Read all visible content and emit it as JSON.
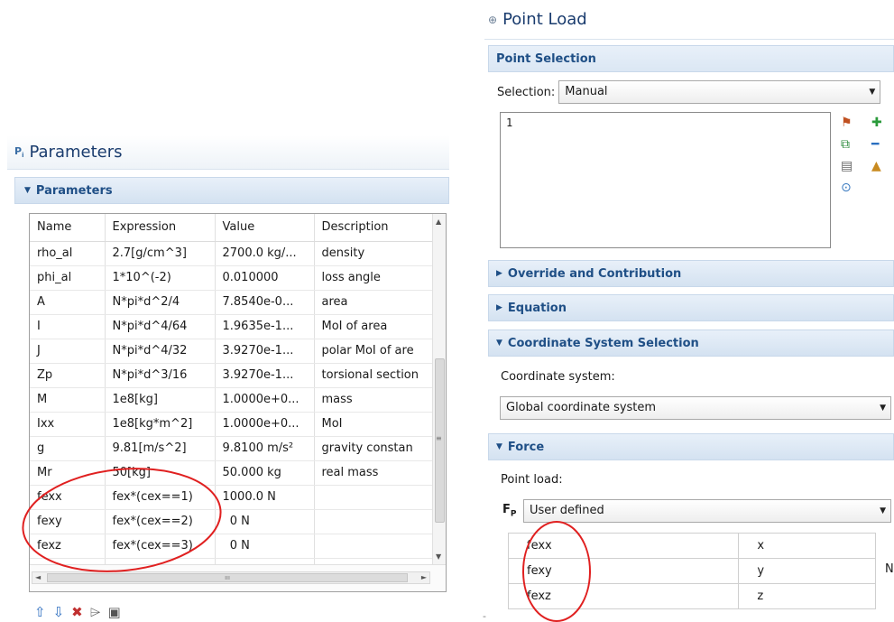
{
  "params_panel": {
    "title": "Parameters",
    "section": "Parameters",
    "columns": [
      "Name",
      "Expression",
      "Value",
      "Description"
    ],
    "rows": [
      [
        "rho_al",
        "2.7[g/cm^3]",
        "2700.0 kg/...",
        "density"
      ],
      [
        "phi_al",
        "1*10^(-2)",
        "0.010000",
        "loss angle"
      ],
      [
        "A",
        "N*pi*d^2/4",
        "7.8540e-0...",
        "area"
      ],
      [
        "I",
        "N*pi*d^4/64",
        "1.9635e-1...",
        "MoI of area"
      ],
      [
        "J",
        "N*pi*d^4/32",
        "3.9270e-1...",
        "polar MoI of are"
      ],
      [
        "Zp",
        "N*pi*d^3/16",
        "3.9270e-1...",
        "torsional section"
      ],
      [
        "M",
        "1e8[kg]",
        "1.0000e+0...",
        "mass"
      ],
      [
        "Ixx",
        "1e8[kg*m^2]",
        "1.0000e+0...",
        "MoI"
      ],
      [
        "g",
        "9.81[m/s^2]",
        "9.8100 m/s²",
        "gravity constan"
      ],
      [
        "Mr",
        "50[kg]",
        "50.000 kg",
        "real mass"
      ],
      [
        "fexx",
        "fex*(cex==1)",
        "1000.0 N",
        ""
      ],
      [
        "fexy",
        "fex*(cex==2)",
        "0 N",
        ""
      ],
      [
        "fexz",
        "fex*(cex==3)",
        "0 N",
        ""
      ]
    ],
    "toolbar": [
      "move-up-icon",
      "move-down-icon",
      "delete-icon",
      "open-icon",
      "save-icon"
    ]
  },
  "point_load": {
    "title": "Point Load",
    "point_selection": {
      "header": "Point Selection",
      "label": "Selection:",
      "value": "Manual",
      "items": [
        "1"
      ]
    },
    "override_header": "Override and Contribution",
    "equation_header": "Equation",
    "coord": {
      "header": "Coordinate System Selection",
      "label": "Coordinate system:",
      "value": "Global coordinate system"
    },
    "force": {
      "header": "Force",
      "label": "Point load:",
      "symbol": "F",
      "subscript": "P",
      "mode": "User defined",
      "rows": [
        [
          "fexx",
          "x"
        ],
        [
          "fexy",
          "y"
        ],
        [
          "fexz",
          "z"
        ]
      ],
      "unit": "N"
    }
  },
  "colors": {
    "accent": "#1f4f86",
    "annotation": "#e02020"
  }
}
